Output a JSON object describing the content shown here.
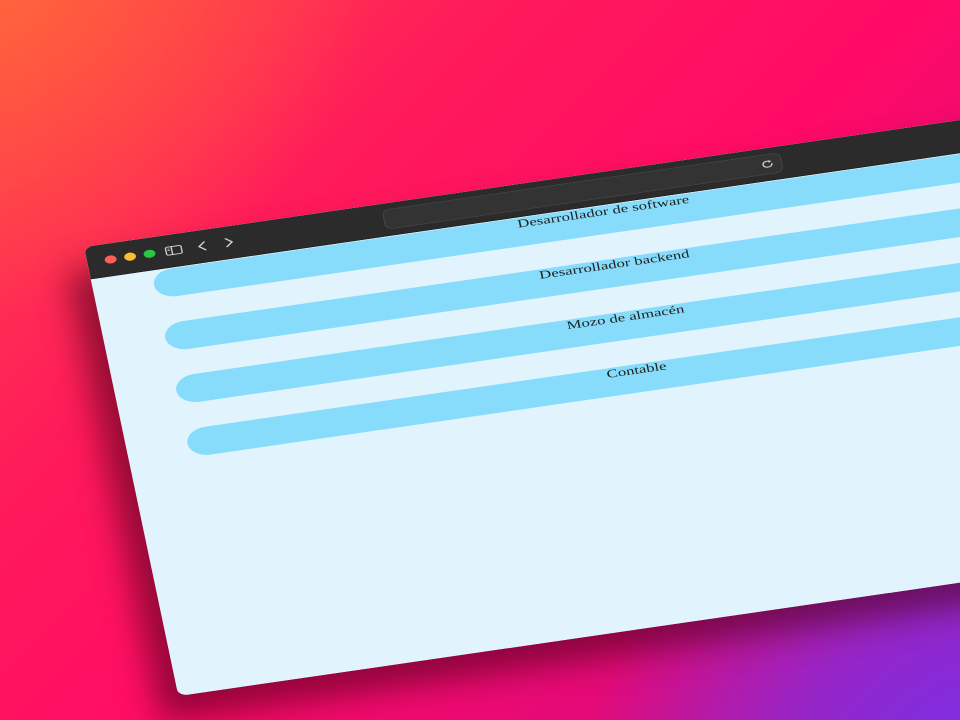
{
  "browser": {
    "address_value": "",
    "icons": {
      "sidebar": "sidebar-toggle-icon",
      "back": "chevron-left-icon",
      "forward": "chevron-right-icon",
      "reload": "reload-icon"
    }
  },
  "jobs": [
    {
      "label": "Desarrollador de software"
    },
    {
      "label": "Desarrollador backend"
    },
    {
      "label": "Mozo de almacén"
    },
    {
      "label": "Contable"
    }
  ],
  "colors": {
    "page_background": "#e1f4fd",
    "item_background": "#86dcfa",
    "titlebar": "#2b2b2b",
    "traffic_red": "#ff5f57",
    "traffic_yellow": "#febc2e",
    "traffic_green": "#28c840"
  }
}
